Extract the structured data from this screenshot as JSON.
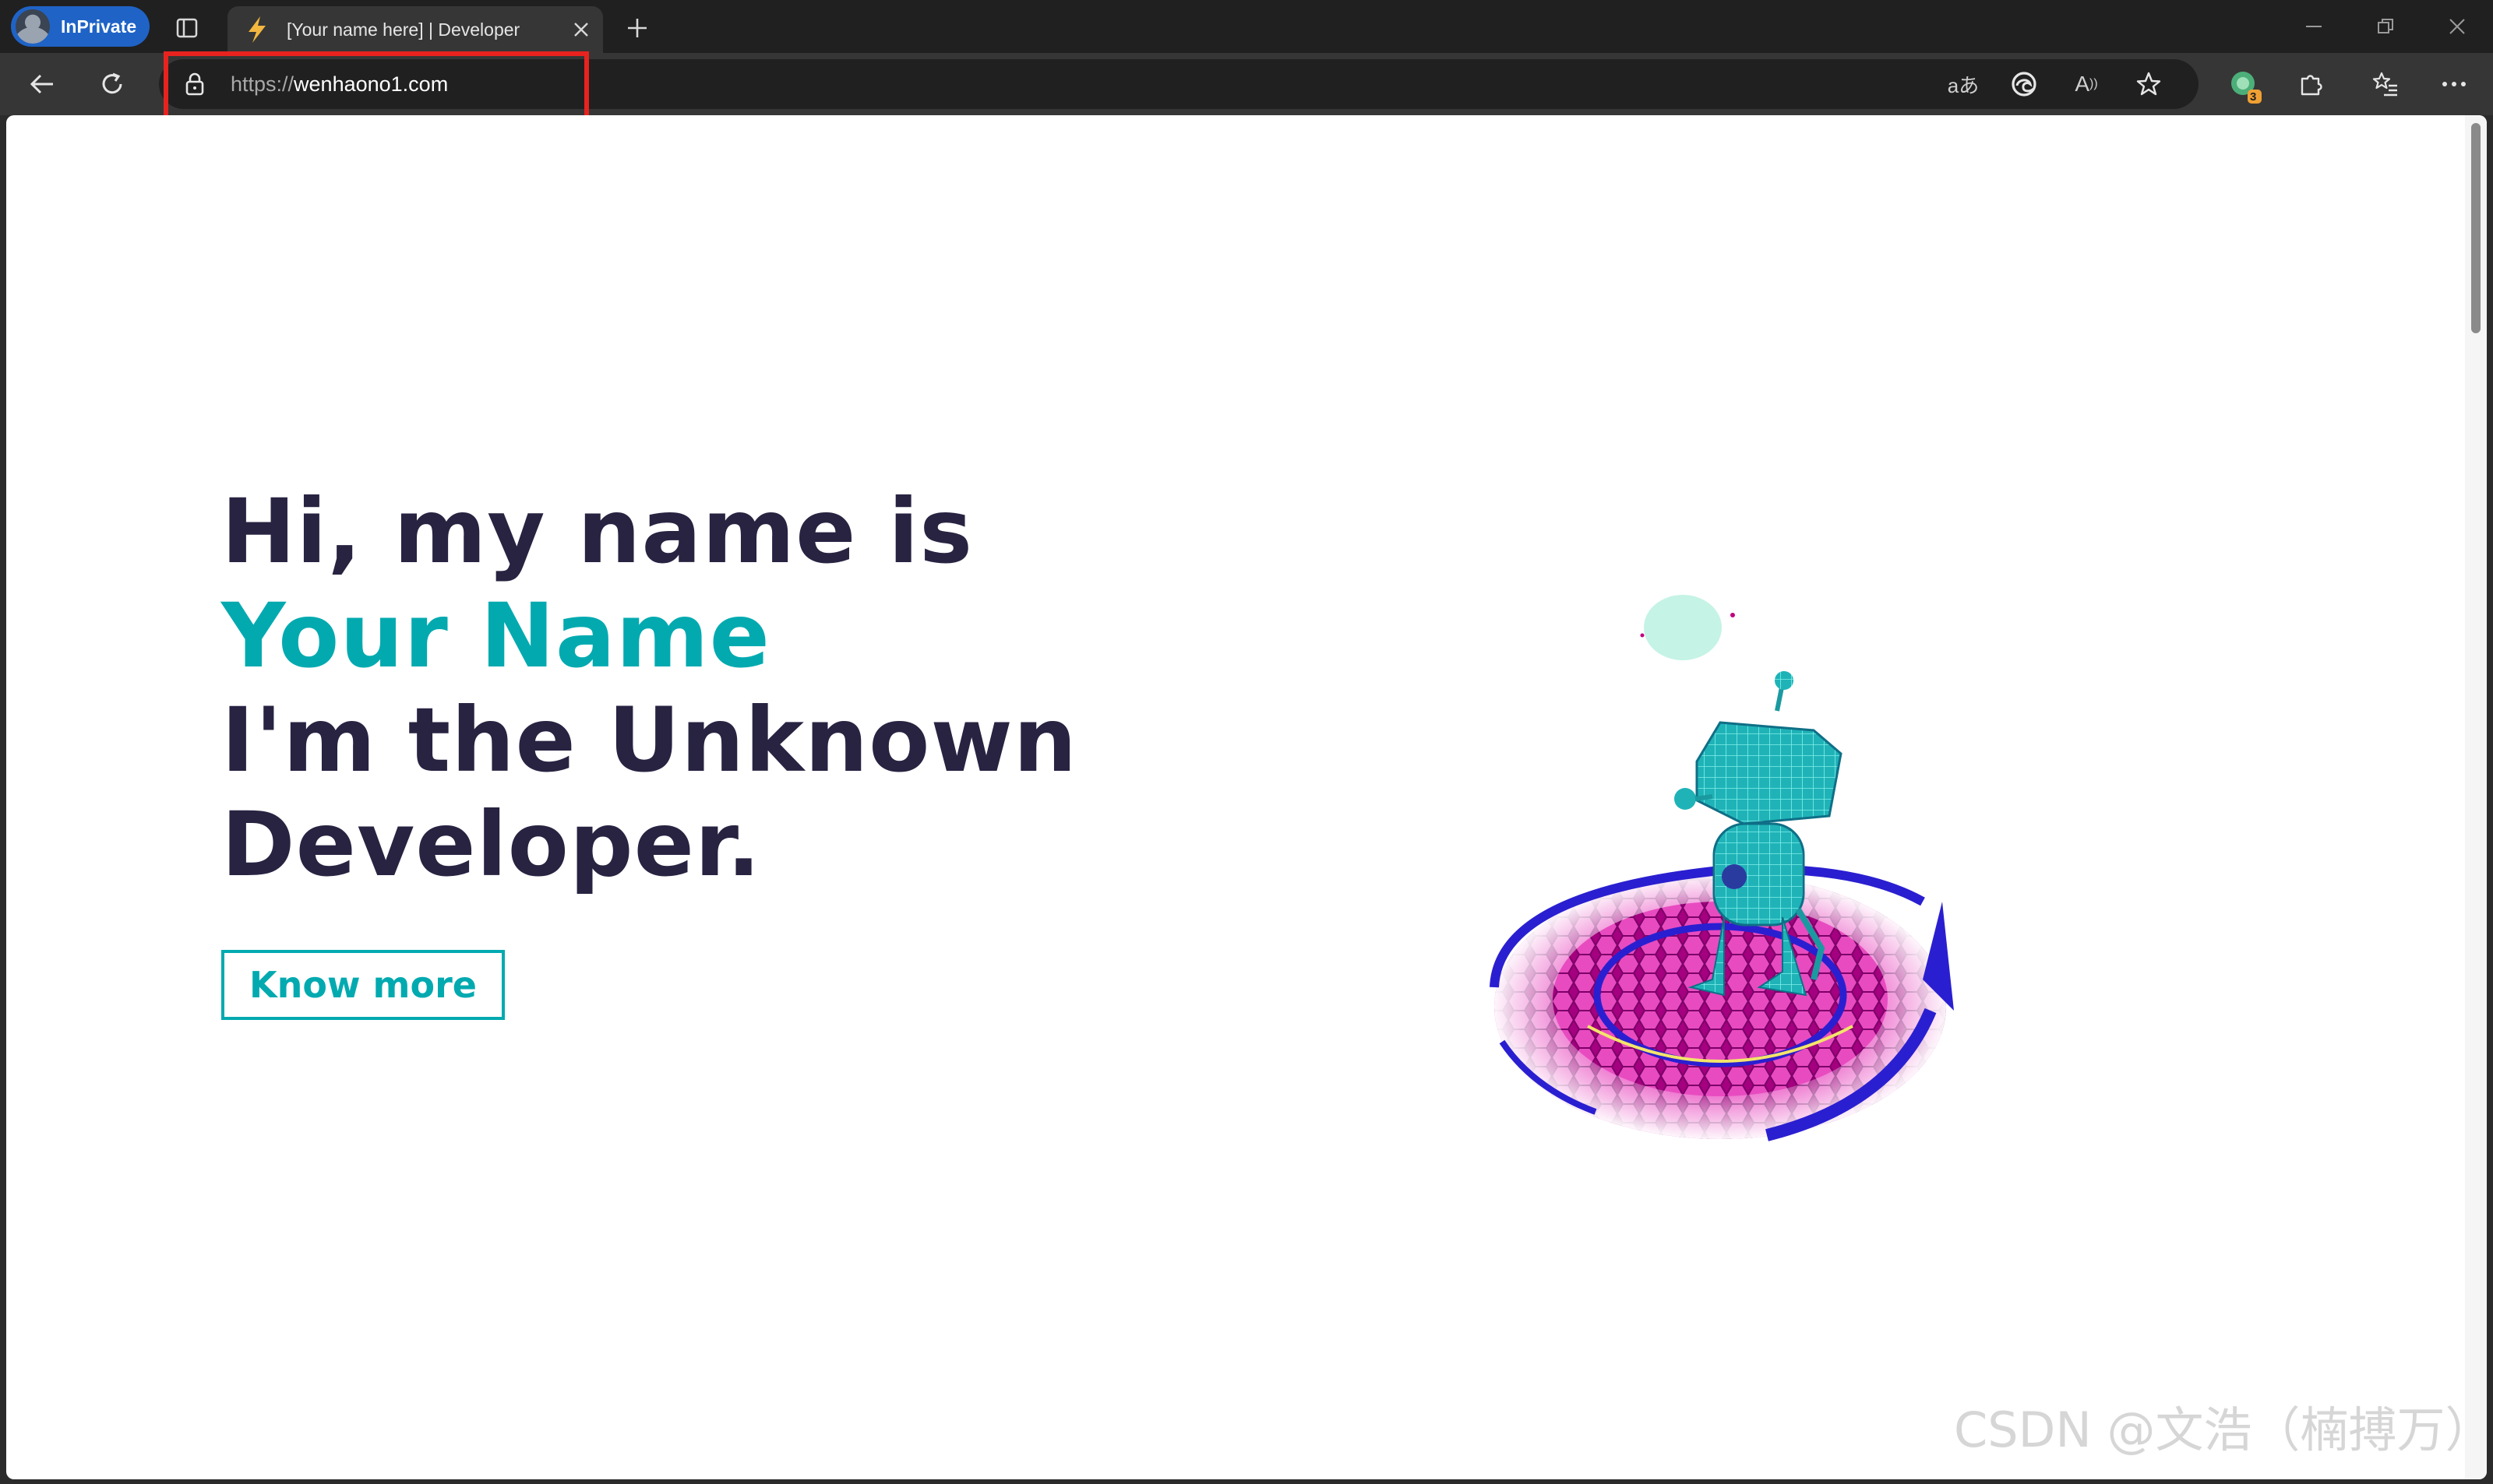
{
  "browser": {
    "inprivate_label": "InPrivate",
    "tab_title": "[Your name here] | Developer",
    "url_scheme": "https://",
    "url_host": "wenhaono1.com",
    "extension_badge": "3",
    "icons": {
      "back": "arrow-left-icon",
      "refresh": "refresh-icon",
      "lock": "lock-icon",
      "translate": "translate-icon",
      "edge": "edge-icon",
      "read_aloud": "read-aloud-icon",
      "favorite": "star-icon",
      "extensions": "puzzle-icon",
      "favorites": "favorites-list-icon",
      "more": "more-icon"
    }
  },
  "page": {
    "hero_line1": "Hi, my name is",
    "hero_name": "Your Name",
    "hero_line3": "I'm the Unknown",
    "hero_line4": "Developer.",
    "cta_label": "Know more"
  },
  "watermark": "CSDN @文浩（楠搏万）",
  "colors": {
    "accent": "#02aab0",
    "heading": "#272341",
    "annotation": "#e8231f"
  }
}
